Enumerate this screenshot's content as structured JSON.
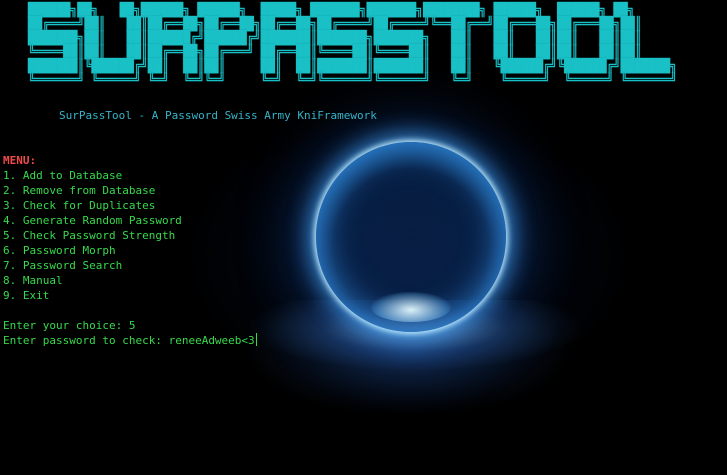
{
  "banner": {
    "title": "SURPASSTOOL",
    "ascii": [
      "██████╗██╗   ██╗██████╗ ██████╗  █████╗ ███████╗███████╗████████╗ ██████╗  ██████╗ ██╗     ",
      "██╔════╝██║   ██║██╔══██╗██╔══██╗██╔══██╗██╔════╝██╔════╝╚══██╔══╝██╔═══██╗██╔═══██╗██║     ",
      "███████╗██║   ██║██████╔╝██████╔╝███████║███████╗███████╗   ██║   ██║   ██║██║   ██║██║     ",
      "╚════██║██║   ██║██╔══██╗██╔═══╝ ██╔══██║╚════██║╚════██║   ██║   ██║   ██║██║   ██║██║     ",
      "███████║╚██████╔╝██║  ██║██║     ██║  ██║███████║███████║   ██║   ╚██████╔╝╚██████╔╝███████╗",
      "╚══════╝ ╚═════╝ ╚═╝  ╚═╝╚═╝     ╚═╝  ╚═╝╚══════╝╚══════╝   ╚═╝    ╚═════╝  ╚═════╝ ╚══════╝"
    ]
  },
  "subtitle": "SurPassTool - A Password Swiss Army KniFramework",
  "menu": {
    "title": "MENU:",
    "items": [
      "1. Add to Database",
      "2. Remove from Database",
      "3. Check for Duplicates",
      "4. Generate Random Password",
      "5. Check Password Strength",
      "6. Password Morph",
      "7. Password Search",
      "8. Manual",
      "9. Exit"
    ]
  },
  "prompts": {
    "choice_label": "Enter your choice: ",
    "choice_value": "5",
    "password_label": "Enter password to check: ",
    "password_value": "reneeAdweeb<3"
  },
  "colors": {
    "banner": "#19c0c6",
    "subtitle": "#36b3c9",
    "menu_text": "#37d94b",
    "menu_title": "#ef4b4b",
    "background": "#000000"
  }
}
